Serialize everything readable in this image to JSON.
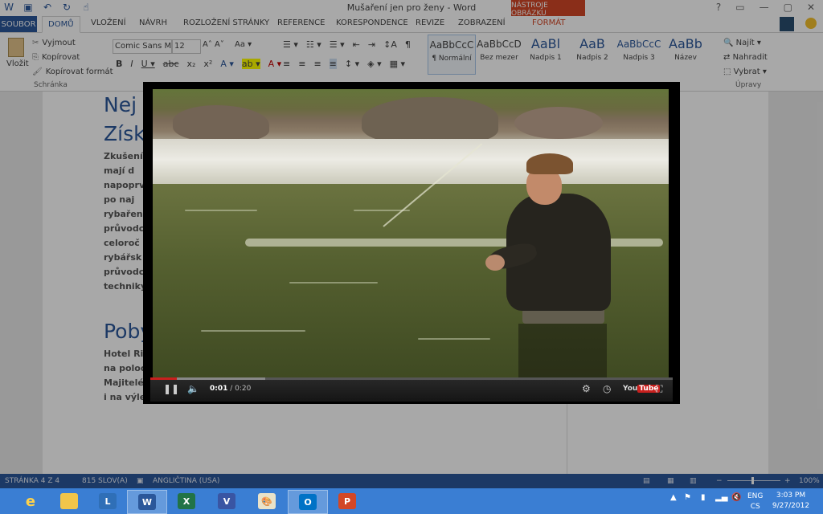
{
  "window": {
    "title": "Mušaření jen pro ženy - Word",
    "context_tab_title": "NÁSTROJE OBRÁZKU",
    "controls": [
      "?",
      "▭",
      "—",
      "▢",
      "✕"
    ]
  },
  "ribbon_tabs": [
    "SOUBOR",
    "DOMŮ",
    "VLOŽENÍ",
    "NÁVRH",
    "ROZLOŽENÍ STRÁNKY",
    "REFERENCE",
    "KORESPONDENCE",
    "REVIZE",
    "ZOBRAZENÍ",
    "FORMÁT"
  ],
  "clipboard": {
    "paste": "Vložit",
    "cut": "Vyjmout",
    "copy": "Kopírovat",
    "format_painter": "Kopírovat formát",
    "group": "Schránka"
  },
  "font": {
    "name": "Comic Sans M",
    "size": "12",
    "grow_shrink": "A˄ A˅",
    "case": "Aa ▾",
    "row2": [
      "B",
      "I",
      "U ▾",
      "abc",
      "x₂",
      "x²",
      "A ▾",
      "ab ▾",
      "A ▾"
    ]
  },
  "paragraph": {
    "row1": [
      "☰ ▾",
      "☷ ▾",
      "☰ ▾",
      "⇤",
      "⇥",
      "↕A",
      "¶"
    ],
    "row2": [
      "≡",
      "≡",
      "≡",
      "≡",
      "↕ ▾",
      "◈ ▾",
      "▦ ▾"
    ]
  },
  "styles": [
    {
      "sample": "AaBbCcC",
      "name": "¶ Normální"
    },
    {
      "sample": "AaBbCcD",
      "name": "Bez mezer"
    },
    {
      "sample": "AaBl",
      "name": "Nadpis 1"
    },
    {
      "sample": "AaB",
      "name": "Nadpis 2"
    },
    {
      "sample": "AaBbCcC",
      "name": "Nadpis 3"
    },
    {
      "sample": "AaBb",
      "name": "Název"
    }
  ],
  "editing": {
    "find": "Najít ▾",
    "replace": "Nahradit",
    "select": "Vybrat ▾",
    "group": "Úpravy"
  },
  "document": {
    "heading1": "Nej",
    "heading1b": "Získ",
    "para1": [
      "Zkušení",
      "mají d",
      "napoprv",
      "po naj",
      "rybařen",
      "průvodc",
      "celoroč",
      "rybářsk",
      "průvodc",
      "techniky"
    ],
    "heading2": "Pobyt",
    "para2": [
      "Hotel Ri",
      "na poloo",
      "Majitelé",
      "i na výle"
    ]
  },
  "video": {
    "time_current": "0:01",
    "time_total": " / 0:20",
    "progress": 0.05,
    "buffered": 0.22,
    "brand_you": "You",
    "brand_tube": "Tube"
  },
  "status_bar": {
    "page": "STRÁNKA 4 Z 4",
    "words": "815 SLOV(A)",
    "language": "ANGLIČTINA (USA)",
    "zoom": "100%"
  },
  "taskbar": {
    "apps": [
      "IE",
      "Explorer",
      "Lync",
      "W",
      "X",
      "V",
      "Paint",
      "O",
      "P"
    ],
    "lang_top": "ENG",
    "lang_bottom": "CS",
    "time": "3:03 PM",
    "date": "9/27/2012"
  },
  "colors": {
    "word_blue": "#2b579a",
    "context_red": "#d24726",
    "taskbar_blue": "#3a7ed3",
    "yt_red": "#c8201e"
  }
}
